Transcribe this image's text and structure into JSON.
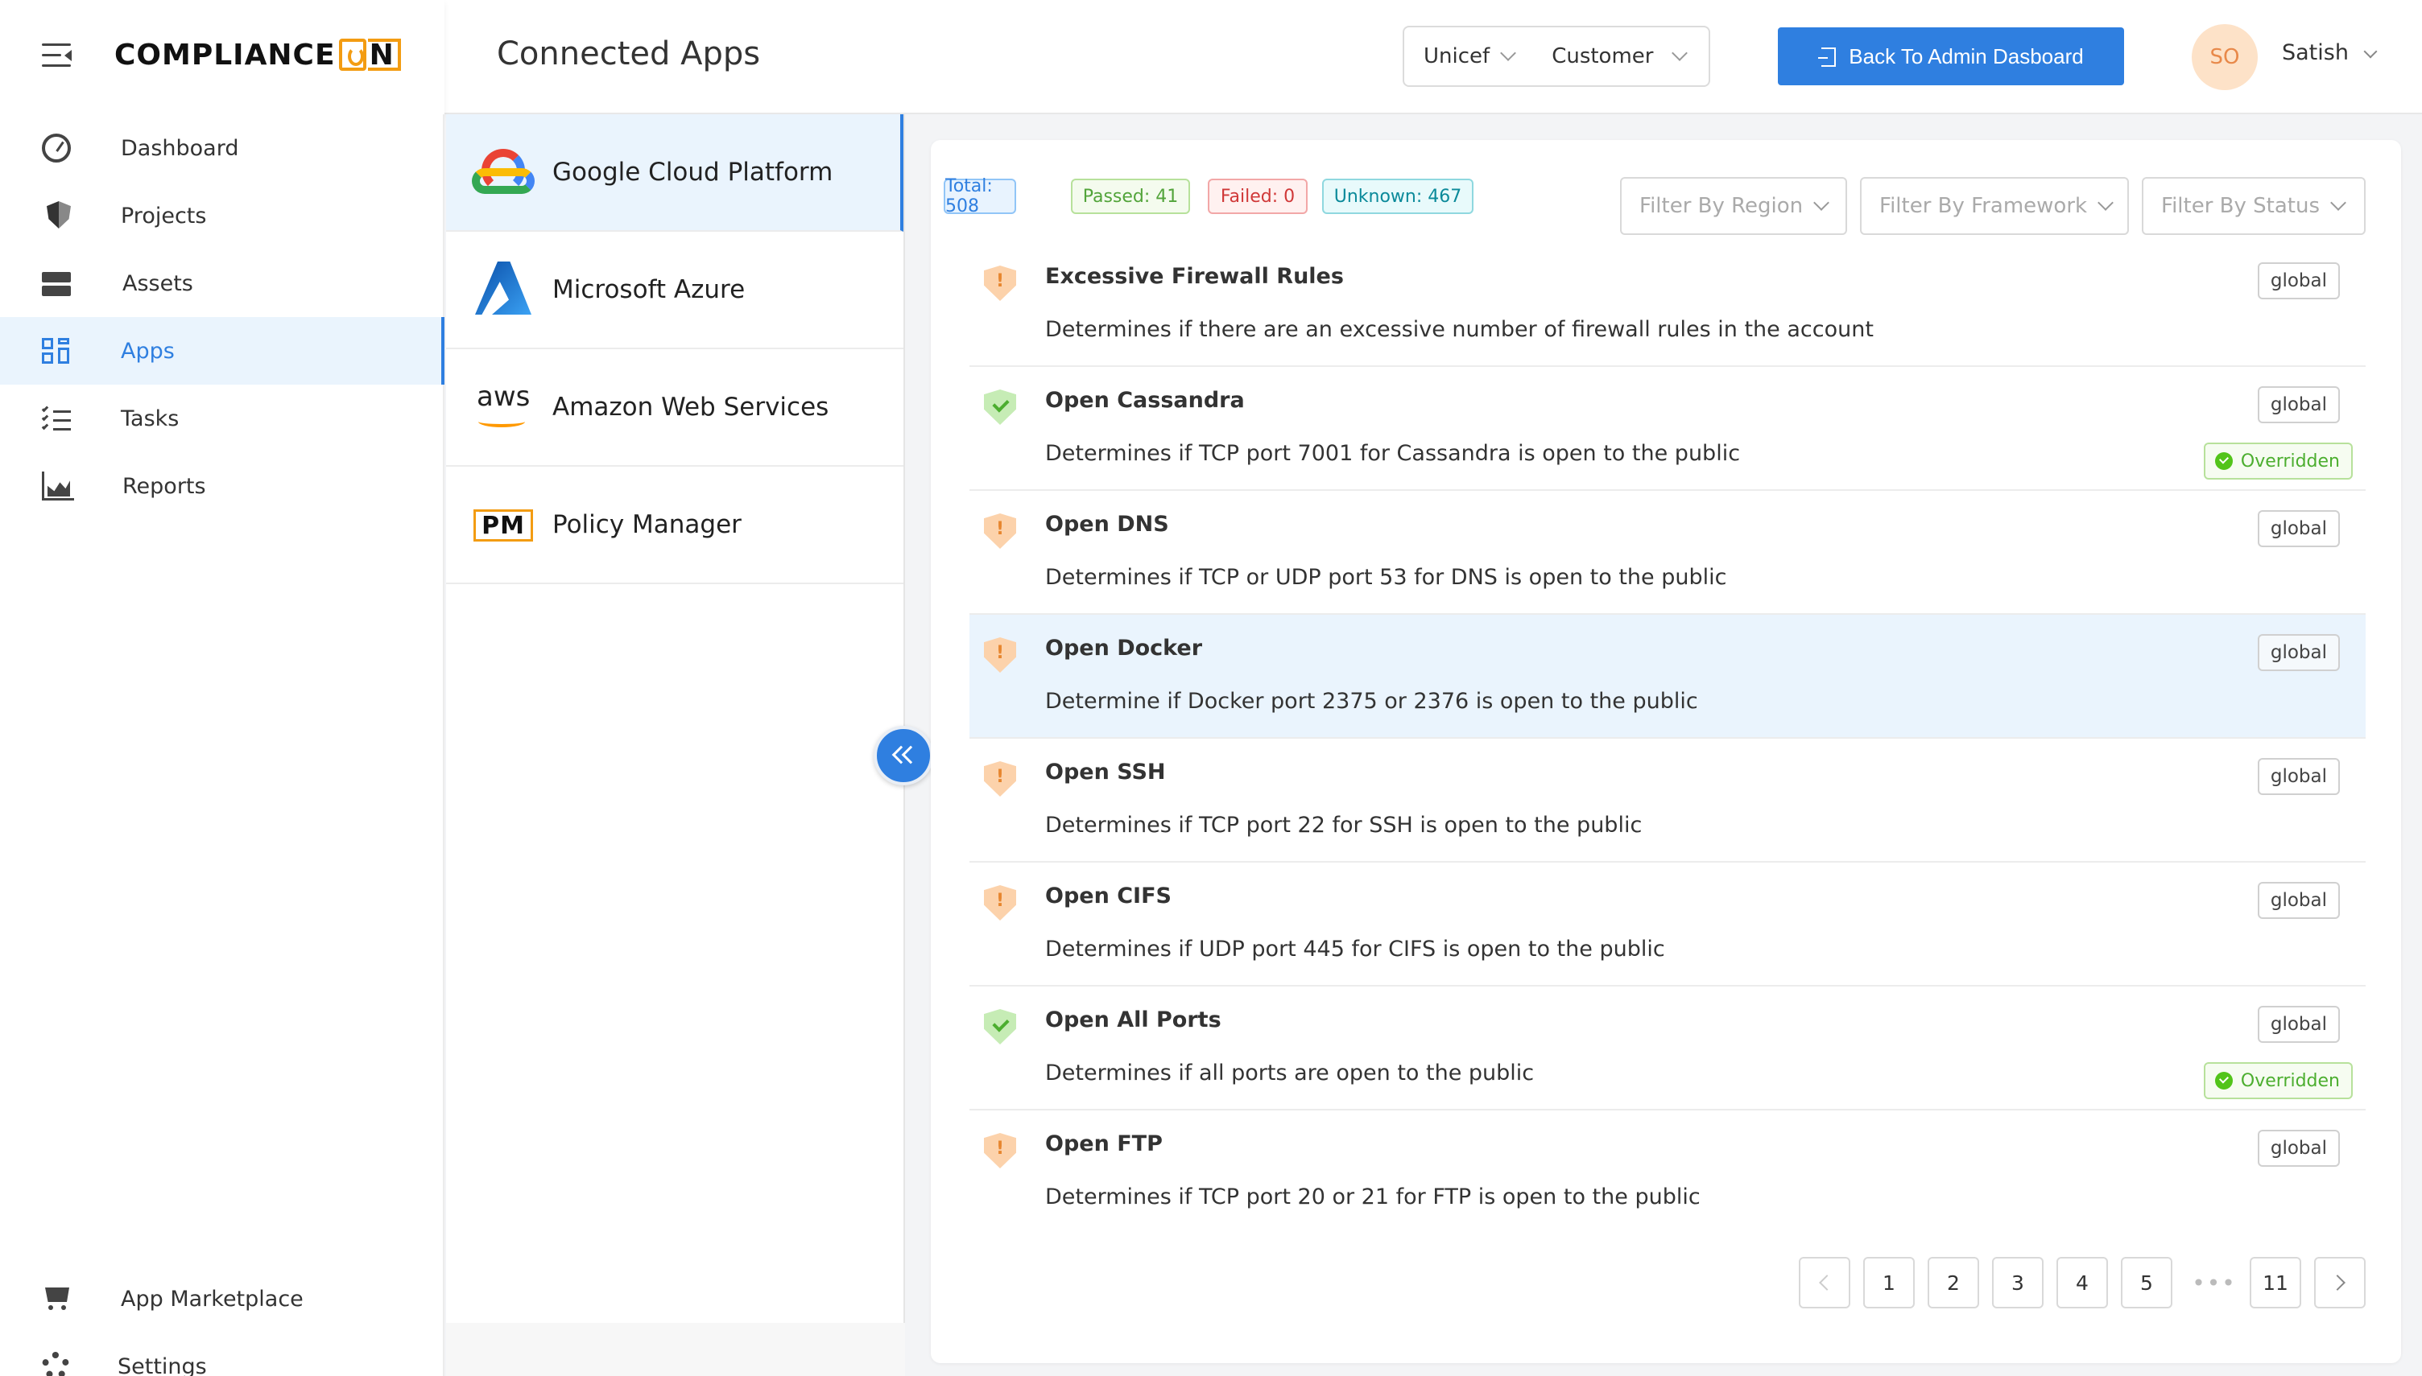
{
  "header": {
    "page_title": "Connected Apps",
    "org": "Unicef",
    "role": "Customer",
    "admin_button": "Back To Admin Dasboard",
    "avatar_initials": "SO",
    "user_name": "Satish"
  },
  "brand": {
    "logo_text_a": "COMPLIANCE",
    "logo_text_b": "N"
  },
  "sidebar": {
    "items": [
      {
        "label": "Dashboard",
        "icon": "dashboard-icon"
      },
      {
        "label": "Projects",
        "icon": "shield-icon"
      },
      {
        "label": "Assets",
        "icon": "server-icon"
      },
      {
        "label": "Apps",
        "icon": "apps-grid-icon",
        "active": true
      },
      {
        "label": "Tasks",
        "icon": "tasks-list-icon"
      },
      {
        "label": "Reports",
        "icon": "area-chart-icon"
      }
    ],
    "bottom_items": [
      {
        "label": "App Marketplace",
        "icon": "cart-icon"
      },
      {
        "label": "Settings",
        "icon": "gear-icon"
      }
    ]
  },
  "apps": [
    {
      "name": "Google Cloud Platform",
      "icon": "gcp-logo",
      "active": true
    },
    {
      "name": "Microsoft Azure",
      "icon": "azure-logo"
    },
    {
      "name": "Amazon Web Services",
      "icon": "aws-logo",
      "logo_text": "aws"
    },
    {
      "name": "Policy Manager",
      "icon": "pm-logo",
      "logo_text": "PM"
    }
  ],
  "summary": {
    "total": "Total: 508",
    "passed": "Passed: 41",
    "failed": "Failed: 0",
    "unknown": "Unknown: 467"
  },
  "filters": {
    "region": "Filter By Region",
    "framework": "Filter By Framework",
    "status": "Filter By Status"
  },
  "rules": [
    {
      "title": "Excessive Firewall Rules",
      "description": "Determines if there are an excessive number of firewall rules in the account",
      "scope": "global",
      "status": "warning"
    },
    {
      "title": "Open Cassandra",
      "description": "Determines if TCP port 7001 for Cassandra is open to the public",
      "scope": "global",
      "status": "passed",
      "override": "Overridden"
    },
    {
      "title": "Open DNS",
      "description": "Determines if TCP or UDP port 53 for DNS is open to the public",
      "scope": "global",
      "status": "warning"
    },
    {
      "title": "Open Docker",
      "description": "Determine if Docker port 2375 or 2376 is open to the public",
      "scope": "global",
      "status": "warning",
      "highlighted": true
    },
    {
      "title": "Open SSH",
      "description": "Determines if TCP port 22 for SSH is open to the public",
      "scope": "global",
      "status": "warning"
    },
    {
      "title": "Open CIFS",
      "description": "Determines if UDP port 445 for CIFS is open to the public",
      "scope": "global",
      "status": "warning"
    },
    {
      "title": "Open All Ports",
      "description": "Determines if all ports are open to the public",
      "scope": "global",
      "status": "passed",
      "override": "Overridden"
    },
    {
      "title": "Open FTP",
      "description": "Determines if TCP port 20 or 21 for FTP is open to the public",
      "scope": "global",
      "status": "warning"
    }
  ],
  "pagination": {
    "pages": [
      "1",
      "2",
      "3",
      "4",
      "5"
    ],
    "ellipsis": "•••",
    "last_page": "11"
  },
  "colors": {
    "accent": "#2f7fe0",
    "warning": "#e7862f",
    "success": "#4cae2f",
    "danger": "#d03838",
    "info": "#0b8a9a"
  }
}
